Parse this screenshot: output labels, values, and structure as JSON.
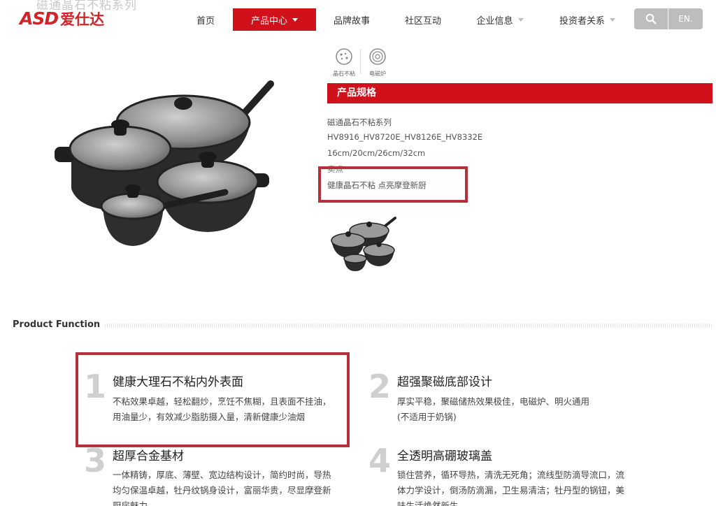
{
  "header": {
    "ghost_title": "磁通晶石不粘系列",
    "logo_text": "ASD",
    "logo_cn": "爱仕达",
    "nav": [
      {
        "label": "首页",
        "has_caret": false,
        "active": false
      },
      {
        "label": "产品中心",
        "has_caret": true,
        "active": true
      },
      {
        "label": "品牌故事",
        "has_caret": false,
        "active": false
      },
      {
        "label": "社区互动",
        "has_caret": false,
        "active": false
      },
      {
        "label": "企业信息",
        "has_caret": true,
        "active": false
      },
      {
        "label": "投资者关系",
        "has_caret": true,
        "active": false
      }
    ],
    "lang_label": "EN."
  },
  "features": [
    {
      "label": "晶石不粘",
      "icon": "granite-nonstick-icon"
    },
    {
      "label": "电磁炉",
      "icon": "induction-cooker-icon"
    }
  ],
  "spec": {
    "title": "产品规格",
    "series": "磁通晶石不粘系列",
    "models": "HV8916_HV8720E_HV8126E_HV8332E",
    "sizes": "16cm/20cm/26cm/32cm",
    "sell_label": "卖点",
    "selling_point": "健康晶石不粘 点亮摩登新厨"
  },
  "function": {
    "title": "Product Function",
    "items": [
      {
        "num": "1",
        "heading": "健康大理石不粘内外表面",
        "lines": [
          "不粘效果卓越，轻松翻炒，烹饪不焦糊，且表面不挂油，",
          "用油量少，有效减少脂肪摄入量，清新健康少油烟"
        ]
      },
      {
        "num": "2",
        "heading": "超强聚磁底部设计",
        "lines": [
          "厚实平稳，聚磁储热效果极佳，电磁炉、明火通用",
          "(不适用于奶锅)"
        ]
      },
      {
        "num": "3",
        "heading": "超厚合金基材",
        "lines": [
          "一体精铸，厚底、薄壁、宽边结构设计，简约时尚，导热",
          "均匀保温卓越，牡丹纹锅身设计，富丽华贵，尽显摩登新",
          "厨房魅力"
        ]
      },
      {
        "num": "4",
        "heading": "全透明高硼玻璃盖",
        "lines": [
          "锁住营养，循环导热，清洗无死角；流线型防滴导流口，流",
          "体力学设计，倒汤防滴漏，卫生易清洁；牡丹型的锅钮，美",
          "味生活焕然新生"
        ]
      }
    ]
  },
  "colors": {
    "brand_red": "#d0111b",
    "annotation_red": "#b5303a"
  }
}
